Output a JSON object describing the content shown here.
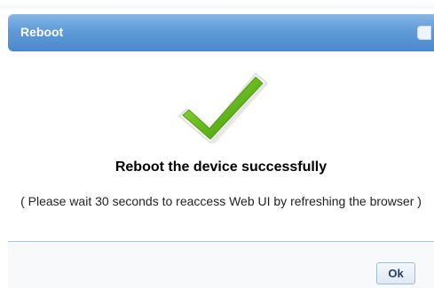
{
  "dialog": {
    "title": "Reboot",
    "icon": "checkmark-success-icon",
    "message": "Reboot the device successfully",
    "note": "( Please wait 30 seconds to reaccess Web UI by refreshing the browser )",
    "ok_label": "Ok"
  },
  "colors": {
    "titlebar": "#5f9bd8",
    "check_green": "#63b31a",
    "button_border": "#9fbbd9"
  }
}
